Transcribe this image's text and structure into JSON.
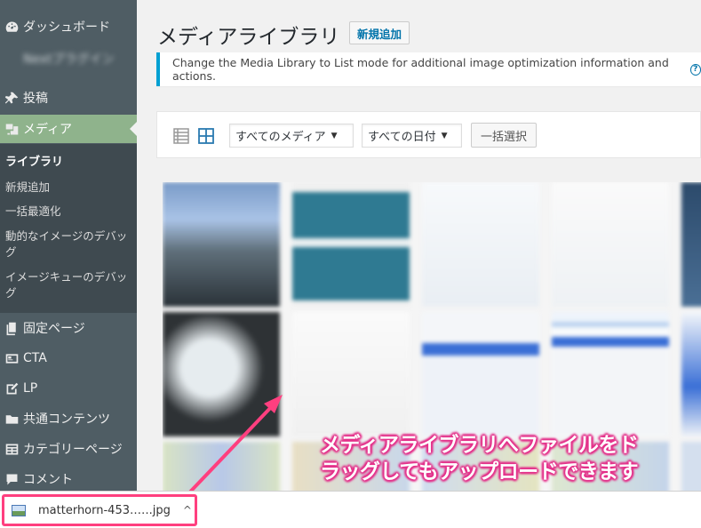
{
  "sidebar": {
    "items": [
      {
        "label": "ダッシュボード",
        "icon": "dashboard-icon"
      },
      {
        "label": "Nextプラグイン",
        "icon": "none"
      },
      {
        "label": "投稿",
        "icon": "pin-icon"
      },
      {
        "label": "メディア",
        "icon": "media-icon"
      },
      {
        "label": "固定ページ",
        "icon": "pages-icon"
      },
      {
        "label": "CTA",
        "icon": "cta-icon"
      },
      {
        "label": "LP",
        "icon": "lp-icon"
      },
      {
        "label": "共通コンテンツ",
        "icon": "folder-icon"
      },
      {
        "label": "カテゴリーページ",
        "icon": "table-icon"
      },
      {
        "label": "コメント",
        "icon": "comment-icon"
      }
    ],
    "submenu": [
      {
        "label": "ライブラリ"
      },
      {
        "label": "新規追加"
      },
      {
        "label": "一括最適化"
      },
      {
        "label": "動的なイメージのデバッグ"
      },
      {
        "label": "イメージキューのデバッグ"
      }
    ]
  },
  "header": {
    "title": "メディアライブラリ",
    "add_new": "新規追加"
  },
  "notice": {
    "text": "Change the Media Library to List mode for additional image optimization information and actions.",
    "help": "?"
  },
  "toolbar": {
    "filter_media": "すべてのメディア",
    "filter_date": "すべての日付",
    "bulk_select": "一括選択"
  },
  "download": {
    "filename": "matterhorn-453…‥.jpg",
    "chevron": "^"
  },
  "callout": {
    "line1": "メディアライブラリへファイルをド",
    "line2": "ラッグしてもアップロードできます"
  },
  "colors": {
    "sidebar_bg": "#4f5d64",
    "current_bg": "#8fb38c",
    "accent": "#0073aa",
    "annotation": "#ff3f7f"
  }
}
